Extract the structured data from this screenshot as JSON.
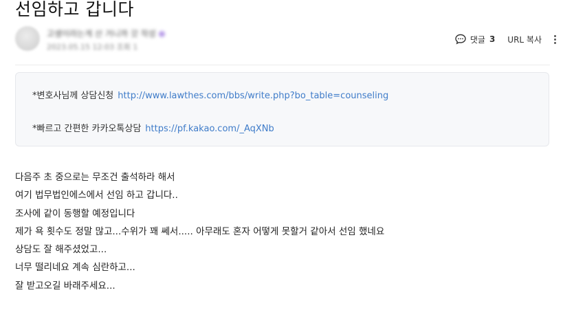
{
  "post": {
    "title": "선임하고 갑니다",
    "author_name": "고생이라는게 산 거니까 갓 작성",
    "date": "2023.05.15 12:03 조회 1"
  },
  "actions": {
    "comment_label": "댓글",
    "comment_count": "3",
    "url_copy_label": "URL 복사"
  },
  "notice": [
    {
      "text": "*변호사님께 상담신청",
      "link": "http://www.lawthes.com/bbs/write.php?bo_table=counseling"
    },
    {
      "text": "*빠르고 간편한 카카오톡상담",
      "link": "https://pf.kakao.com/_AqXNb"
    }
  ],
  "body_lines": [
    "다음주 초 중으로는 무조건 출석하라 해서",
    "여기 법무법인에스에서 선임 하고 갑니다..",
    "조사에 같이 동행할 예정입니다",
    "제가 욕 횟수도 정말 많고...수위가 꽤 쎄서..... 아무래도 혼자 어떻게 못할거 같아서 선임 했네요",
    "상담도 잘 해주셨었고...",
    "너무 떨리네요 계속 심란하고...",
    "잘 받고오길 바래주세요..."
  ],
  "icons": {
    "comment": "speech-bubble-icon",
    "more": "vertical-ellipsis-icon"
  }
}
